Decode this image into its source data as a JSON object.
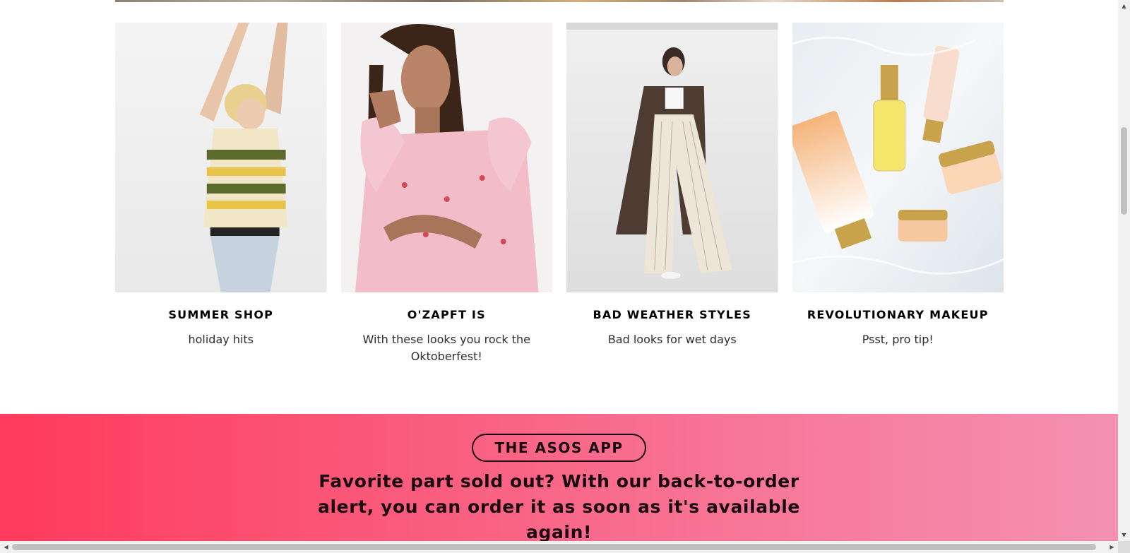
{
  "cards": [
    {
      "title": "SUMMER SHOP",
      "subtitle": "holiday hits"
    },
    {
      "title": "O'ZAPFT IS",
      "subtitle": "With these looks you rock the Oktoberfest!"
    },
    {
      "title": "BAD WEATHER STYLES",
      "subtitle": "Bad looks for wet days"
    },
    {
      "title": "REVOLUTIONARY MAKEUP",
      "subtitle": "Psst, pro tip!"
    }
  ],
  "app_banner": {
    "pill_label": "THE ASOS APP",
    "headline": "Favorite part sold out? With our back-to-order alert, you can order it as soon as it's available again!"
  },
  "scrollbar": {
    "up_arrow": "▲",
    "down_arrow": "▼",
    "left_arrow": "◀",
    "right_arrow": "▶"
  },
  "colors": {
    "banner_start": "#ff3a5c",
    "banner_end": "#f491b3",
    "title_text": "#000000",
    "body_text": "#2d2d2d"
  }
}
